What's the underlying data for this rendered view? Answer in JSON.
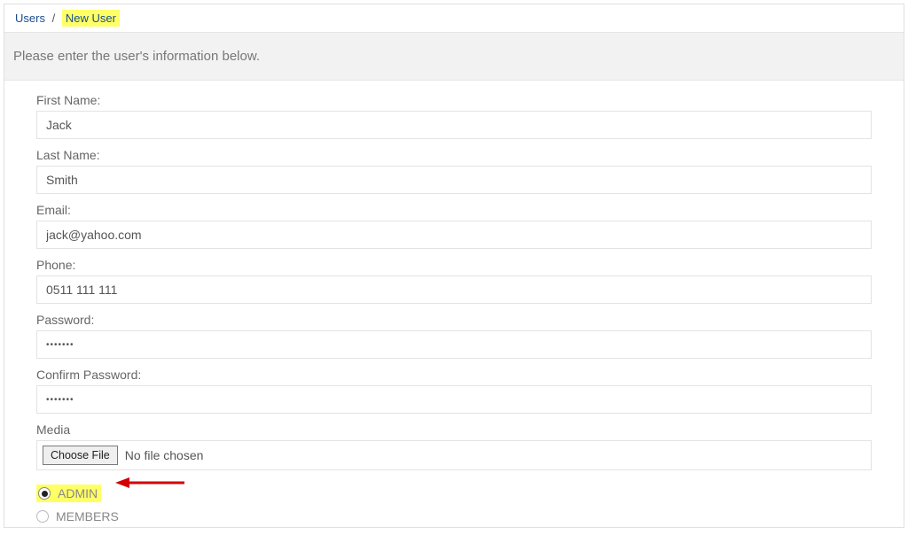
{
  "breadcrumb": {
    "parent": "Users",
    "separator": "/",
    "current": "New User"
  },
  "instruction": "Please enter the user's information below.",
  "fields": {
    "first_name": {
      "label": "First Name:",
      "value": "Jack"
    },
    "last_name": {
      "label": "Last Name:",
      "value": "Smith"
    },
    "email": {
      "label": "Email:",
      "value": "jack@yahoo.com"
    },
    "phone": {
      "label": "Phone:",
      "value": "0511 111 111"
    },
    "password": {
      "label": "Password:",
      "value": "•••••••"
    },
    "confirm": {
      "label": "Confirm Password:",
      "value": "•••••••"
    },
    "media": {
      "label": "Media",
      "button": "Choose File",
      "status": "No file chosen"
    }
  },
  "roles": {
    "options": [
      {
        "value": "ADMIN",
        "selected": true
      },
      {
        "value": "MEMBERS",
        "selected": false
      }
    ]
  }
}
